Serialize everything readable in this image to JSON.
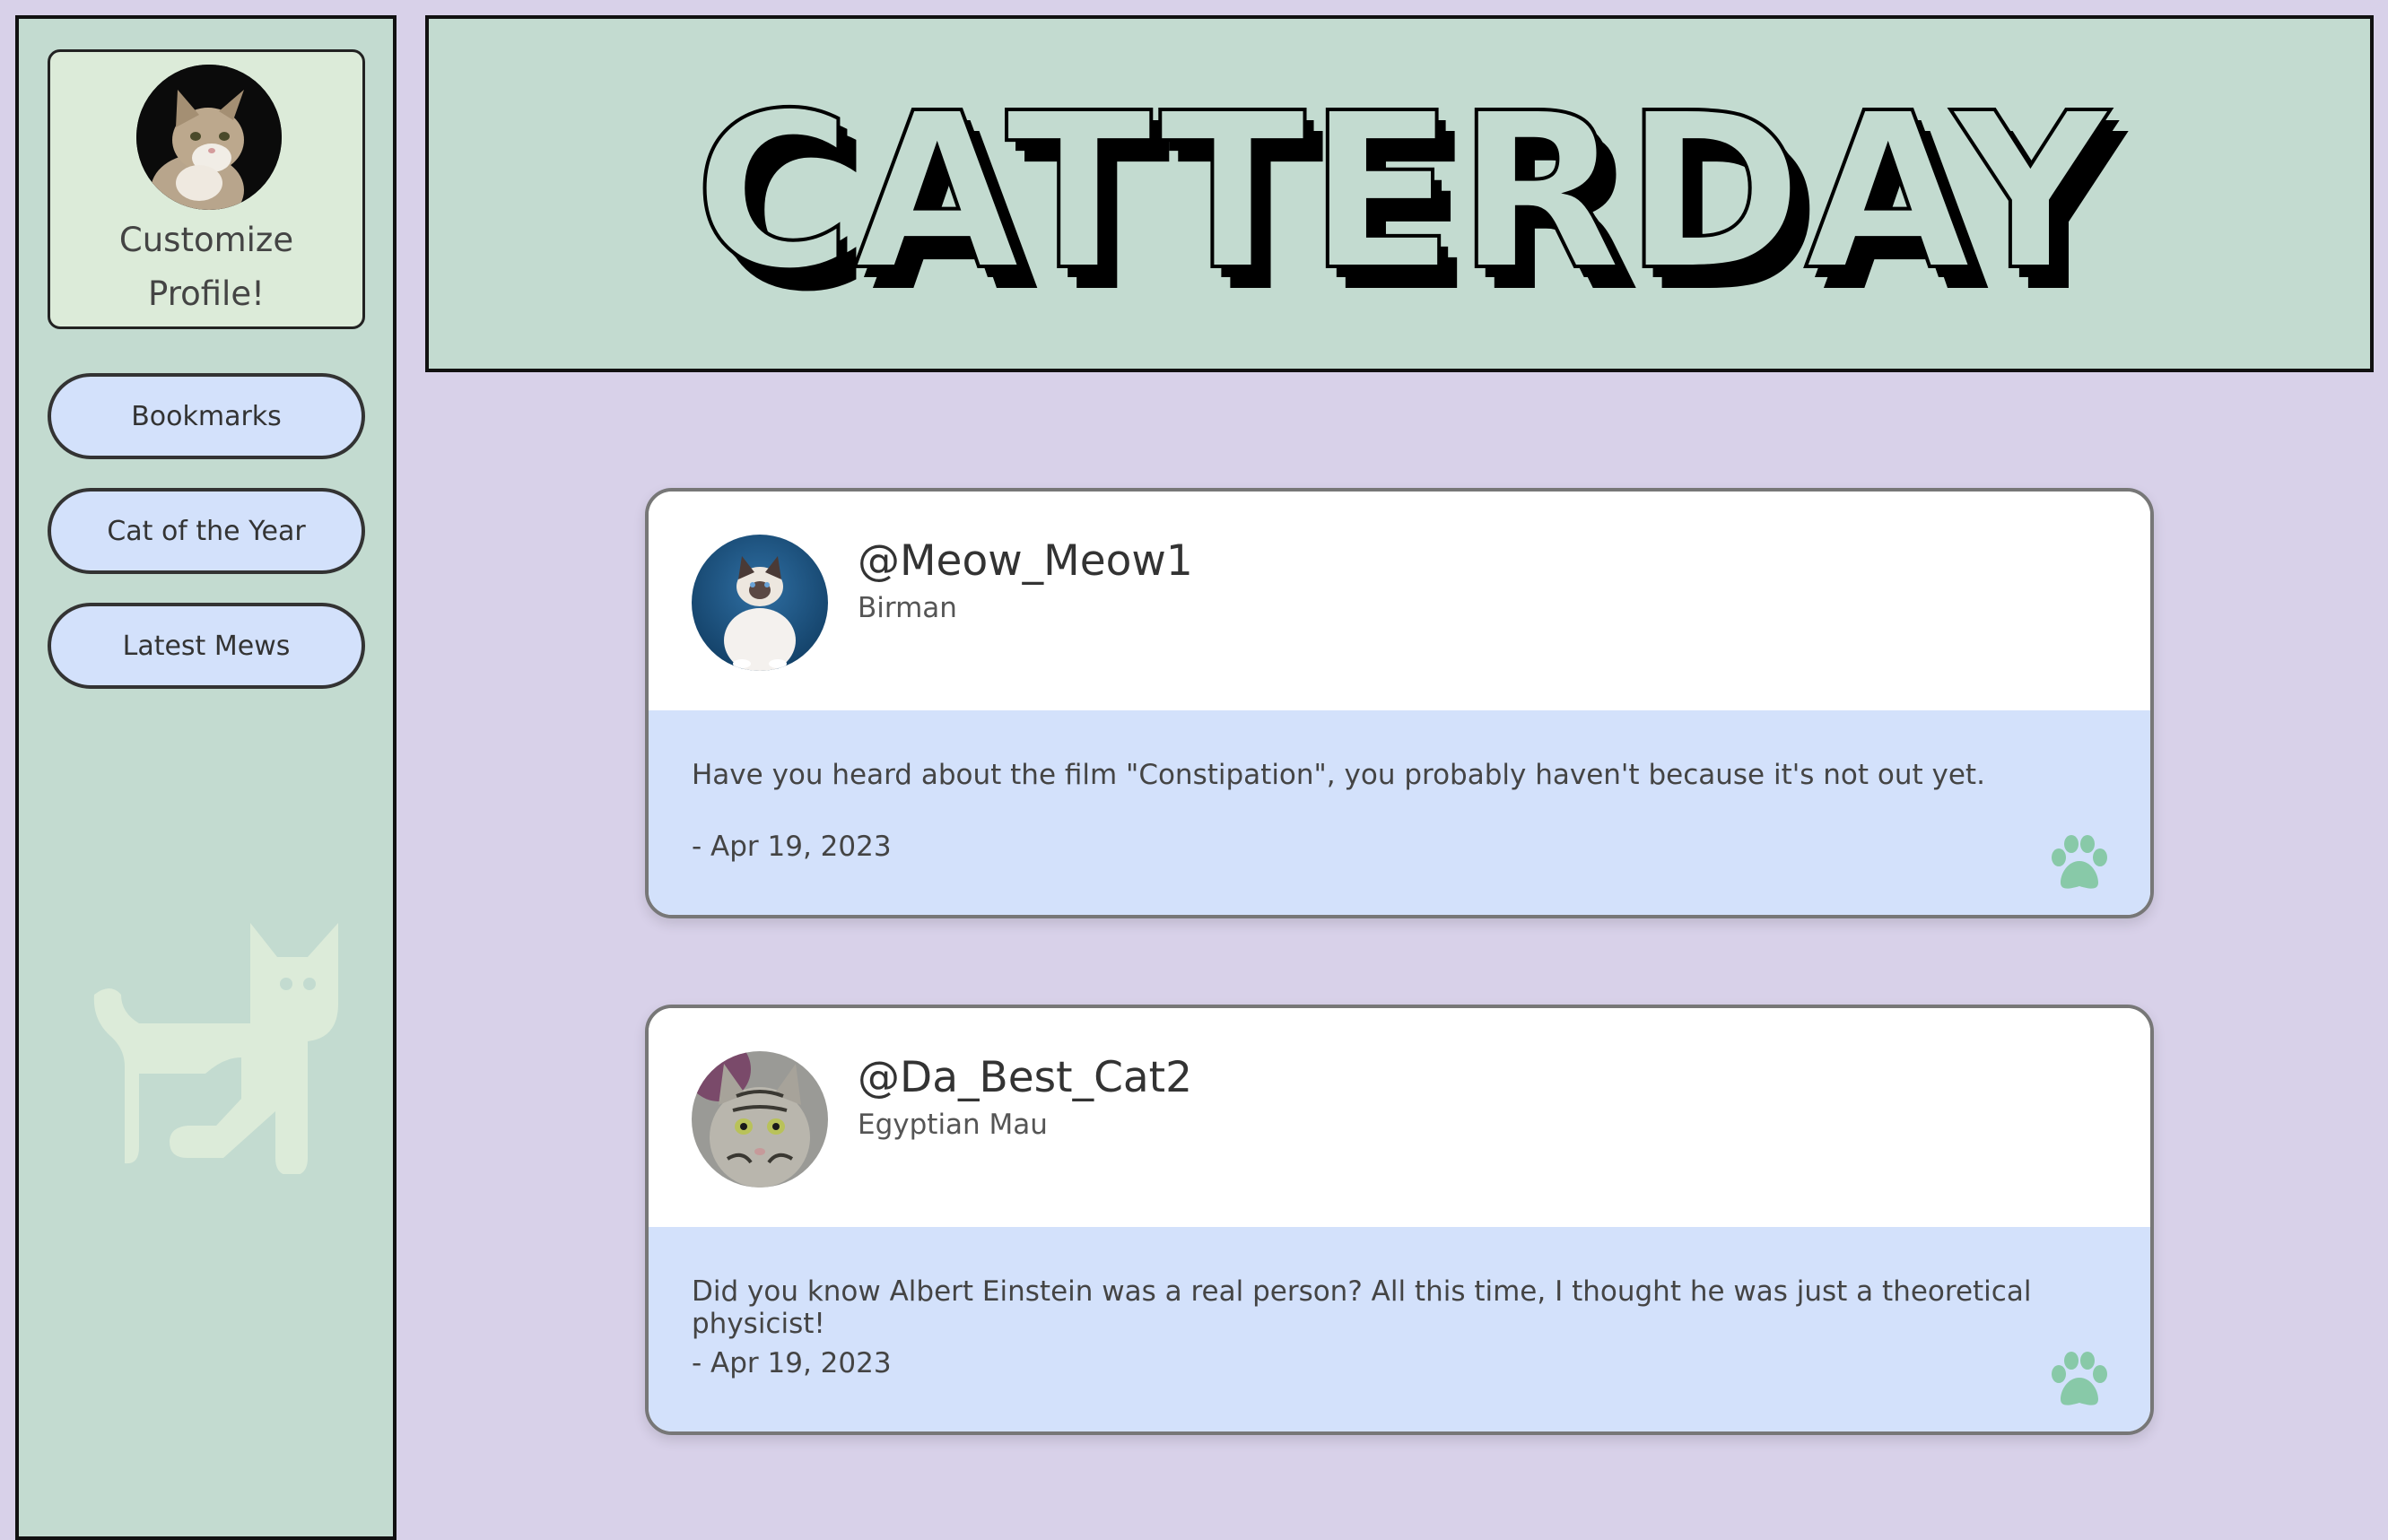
{
  "sidebar": {
    "profile_title_line1": "Customize",
    "profile_title_line2": "Profile!",
    "nav": [
      {
        "label": "Bookmarks"
      },
      {
        "label": "Cat of the Year"
      },
      {
        "label": "Latest Mews"
      }
    ]
  },
  "banner": {
    "title": "CATTERDAY"
  },
  "posts": [
    {
      "username": "@Meow_Meow1",
      "breed": "Birman",
      "text": "Have you heard about the film \"Constipation\", you probably haven't because it's not out yet.",
      "date": "- Apr 19, 2023"
    },
    {
      "username": "@Da_Best_Cat2",
      "breed": "Egyptian Mau",
      "text": "Did you know Albert Einstein was a real person? All this time, I thought he was just a theoretical physicist!",
      "date": "- Apr 19, 2023"
    }
  ],
  "colors": {
    "page_bg": "#d8d1e9",
    "sidebar_bg": "#c3dbd0",
    "profile_card_bg": "#dcebd9",
    "button_bg": "#d3e1fb",
    "post_body_bg": "#d3e1fb",
    "paw_icon": "#88c9a8"
  },
  "icons": {
    "sidebar_decoration": "cat-silhouette-icon",
    "post_action": "paw-icon"
  }
}
